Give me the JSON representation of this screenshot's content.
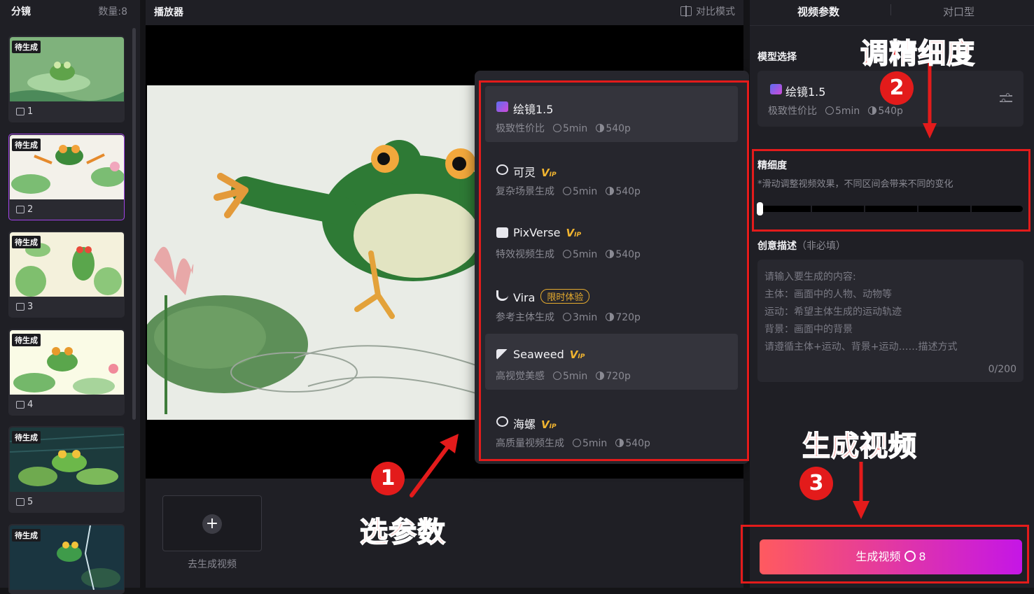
{
  "left_panel": {
    "title": "分镜",
    "count": "数量:8",
    "shots": [
      {
        "tag": "待生成",
        "number": "1"
      },
      {
        "tag": "待生成",
        "number": "2"
      },
      {
        "tag": "待生成",
        "number": "3"
      },
      {
        "tag": "待生成",
        "number": "4"
      },
      {
        "tag": "待生成",
        "number": "5"
      },
      {
        "tag": "待生成",
        "number": ""
      }
    ]
  },
  "player": {
    "title": "播放器",
    "compare_label": "对比模式",
    "add_label": "去生成视频",
    "add_symbol": "+"
  },
  "model_dropdown": [
    {
      "name": "绘镜1.5",
      "desc": "极致性价比",
      "time": "5min",
      "res": "540p",
      "badge": ""
    },
    {
      "name": "可灵",
      "desc": "复杂场景生成",
      "time": "5min",
      "res": "540p",
      "badge": "vip"
    },
    {
      "name": "PixVerse",
      "desc": "特效视频生成",
      "time": "5min",
      "res": "540p",
      "badge": "vip"
    },
    {
      "name": "Vira",
      "desc": "参考主体生成",
      "time": "3min",
      "res": "720p",
      "badge": "限时体验"
    },
    {
      "name": "Seaweed",
      "desc": "高视觉美感",
      "time": "5min",
      "res": "720p",
      "badge": "vip"
    },
    {
      "name": "海螺",
      "desc": "高质量视频生成",
      "time": "5min",
      "res": "540p",
      "badge": "vip"
    }
  ],
  "vip_text": {
    "main": "V",
    "sub": "IP"
  },
  "right_panel": {
    "tabs": [
      "视频参数",
      "对口型"
    ],
    "model_label": "模型选择",
    "selected_model": {
      "name": "绘镜1.5",
      "desc": "极致性价比",
      "time": "5min",
      "res": "540p"
    },
    "detail_label": "精细度",
    "detail_hint": "*滑动调整视频效果，不同区间会带来不同的变化",
    "slider_value": 0,
    "desc_label": "创意描述",
    "desc_optional": "（非必填）",
    "placeholder_lines": [
      "请输入要生成的内容:",
      "主体：画面中的人物、动物等",
      "运动：希望主体生成的运动轨迹",
      "背景：画面中的背景",
      "请遵循主体+运动、背景+运动……描述方式"
    ],
    "char_count": "0/200",
    "generate_label": "生成视频",
    "generate_cost": "8"
  },
  "annotations": {
    "step1_num": "1",
    "step1_text": "选参数",
    "step2_num": "2",
    "step2_text": "调精细度",
    "step3_num": "3",
    "step3_text": "生成视频"
  },
  "colors": {
    "accent_purple": "#a244e8",
    "generate_gradient_start": "#ff5a5f",
    "generate_gradient_end": "#c516e6",
    "annotation_red": "#e31b1b",
    "vip_gold": "#f2b530"
  }
}
